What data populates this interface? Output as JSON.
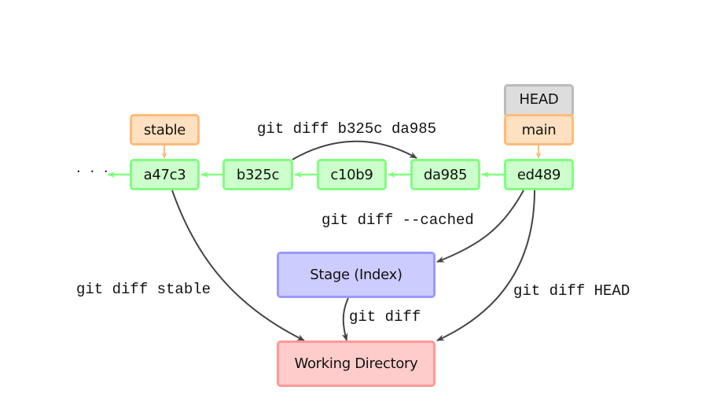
{
  "diagram": {
    "ellipsis": "· · ·",
    "commits": [
      {
        "id": "a47c3"
      },
      {
        "id": "b325c"
      },
      {
        "id": "c10b9"
      },
      {
        "id": "da985"
      },
      {
        "id": "ed489"
      }
    ],
    "refs": {
      "head": "HEAD",
      "main": "main",
      "stable": "stable"
    },
    "areas": {
      "stage": "Stage (Index)",
      "working": "Working Directory"
    },
    "commands": {
      "diff_commits": "git diff b325c da985",
      "diff_cached": "git diff --cached",
      "diff_stable": "git diff stable",
      "diff_head": "git diff HEAD",
      "diff": "git diff"
    },
    "colors": {
      "commit_fill": "#ccffcc",
      "commit_border": "#80ff80",
      "branch_fill": "#ffe0c0",
      "branch_border": "#ffbb77",
      "head_fill": "#dddddd",
      "head_border": "#bbbbbb",
      "stage_fill": "#ccccff",
      "stage_border": "#9999ff",
      "working_fill": "#ffcccc",
      "working_border": "#ff9999",
      "arrow": "#444444"
    }
  }
}
